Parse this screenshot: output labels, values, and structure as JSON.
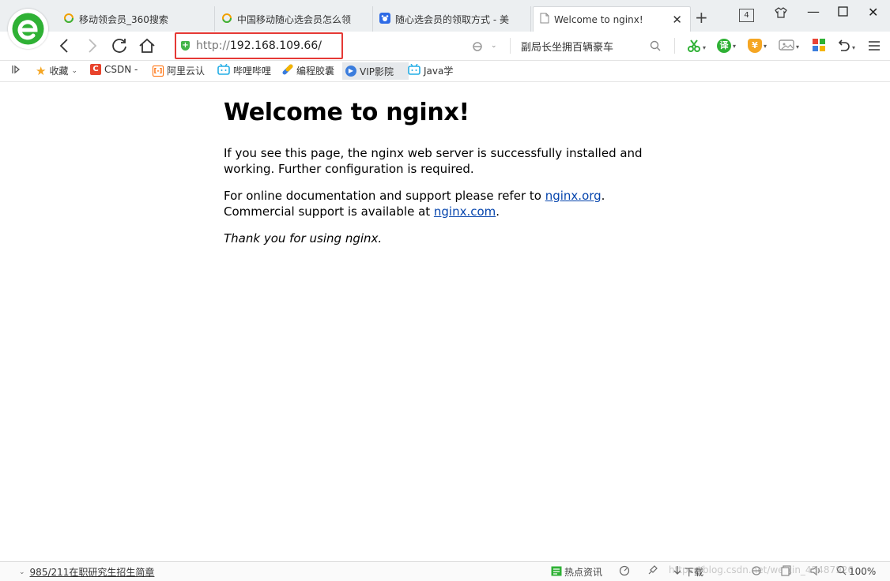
{
  "browser": {
    "tabs": [
      {
        "title": "移动领会员_360搜索",
        "icon": "search-360-icon",
        "active": false
      },
      {
        "title": "中国移动随心选会员怎么领",
        "icon": "search-360-icon",
        "active": false
      },
      {
        "title": "随心选会员的领取方式 - 美",
        "icon": "baidu-paw-icon",
        "active": false
      },
      {
        "title": "Welcome to nginx!",
        "icon": "page-icon",
        "active": true
      }
    ],
    "tab_count": "4",
    "address": {
      "protocol": "http://",
      "host": "192.168.109.66/"
    },
    "search_query": "副局长坐拥百辆豪车",
    "bookmarks": [
      {
        "label": "收藏",
        "icon": "star-icon",
        "color": "#f5a623"
      },
      {
        "label": "CSDN -",
        "icon": "csdn-icon",
        "color": "#e8432c"
      },
      {
        "label": "阿里云认",
        "icon": "aliyun-icon",
        "color": "#ff6a00"
      },
      {
        "label": "哔哩哔哩",
        "icon": "bilibili-icon",
        "color": "#23ade5"
      },
      {
        "label": "编程胶囊",
        "icon": "capsule-icon",
        "color": "#3b7ddd"
      },
      {
        "label": "VIP影院",
        "icon": "play-icon",
        "color": "#3b7ddd"
      },
      {
        "label": "Java学",
        "icon": "bilibili-icon",
        "color": "#23ade5"
      }
    ],
    "ext_icons": {
      "translate": "译",
      "money": "¥"
    },
    "colors": {
      "accent_green": "#43b549",
      "highlight_red": "#e53935",
      "link": "#0645ad"
    }
  },
  "page": {
    "heading": "Welcome to nginx!",
    "p1": "If you see this page, the nginx web server is successfully installed and working. Further configuration is required.",
    "p2_prefix": "For online documentation and support please refer to ",
    "p2_link1": "nginx.org",
    "p2_mid": ".",
    "p2_line2": "Commercial support is available at ",
    "p2_link2": "nginx.com",
    "p2_end": ".",
    "p3": "Thank you for using nginx."
  },
  "statusbar": {
    "news": "985/211在职研究生招生简章",
    "hot_news": "热点资讯",
    "download": "下载",
    "watermark": "https://blog.csdn.net/weixin_45487926",
    "zoom": "100%"
  }
}
